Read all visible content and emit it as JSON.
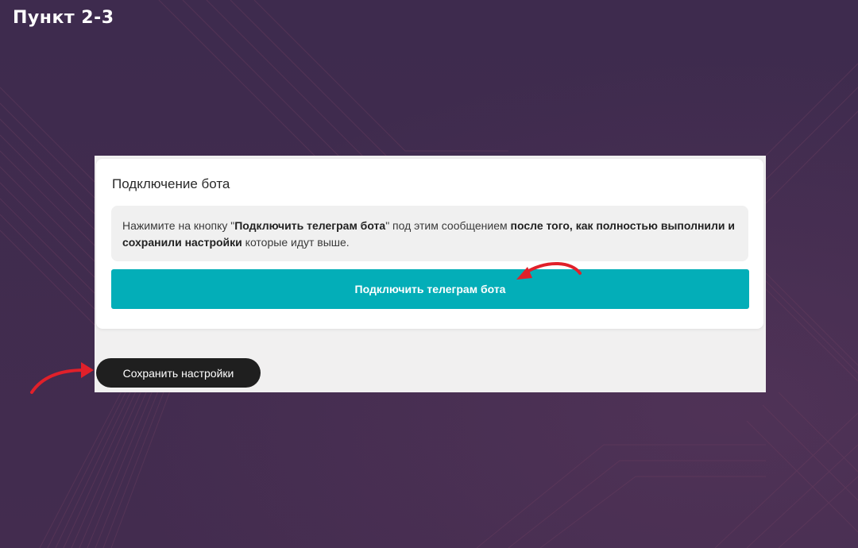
{
  "step_title": "Пункт 2-3",
  "card": {
    "title": "Подключение бота",
    "notice": {
      "part1": "Нажимите на кнопку \"",
      "bold1": "Подключить телеграм бота",
      "part2": "\" под этим сообщением ",
      "bold2": "после того, как полностью выполнили и сохранили настройки",
      "part3": " которые идут выше."
    },
    "connect_button_label": "Подключить телеграм бота"
  },
  "save_button_label": "Сохранить настройки",
  "colors": {
    "background": "#3f2b4d",
    "accent": "#03aeb8",
    "save_button": "#1f1f1f",
    "arrow": "#e0202a"
  },
  "icons": {
    "annotation_arrow": "red-curved-arrow-icon"
  }
}
